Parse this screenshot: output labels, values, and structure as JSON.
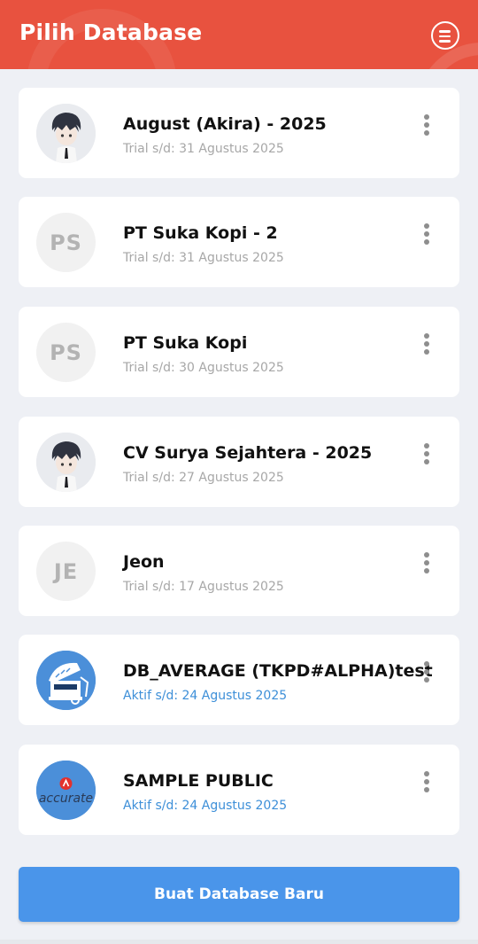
{
  "header": {
    "title": "Pilih Database",
    "menu_icon": "menu-icon"
  },
  "databases": [
    {
      "name": "August (Akira) - 2025",
      "status": "Trial s/d: 31 Agustus 2025",
      "avatar_type": "photo",
      "active": false
    },
    {
      "name": "PT Suka Kopi - 2",
      "status": "Trial s/d: 31 Agustus 2025",
      "avatar_type": "initials",
      "initials": "PS",
      "active": false
    },
    {
      "name": "PT Suka Kopi",
      "status": "Trial s/d: 30 Agustus 2025",
      "avatar_type": "initials",
      "initials": "PS",
      "active": false
    },
    {
      "name": "CV Surya Sejahtera - 2025",
      "status": "Trial s/d: 27 Agustus 2025",
      "avatar_type": "photo",
      "active": false
    },
    {
      "name": "Jeon",
      "status": "Trial s/d: 17 Agustus 2025",
      "avatar_type": "initials",
      "initials": "JE",
      "active": false
    },
    {
      "name": "DB_AVERAGE (TKPD#ALPHA)test",
      "status": "Aktif s/d: 24 Agustus 2025",
      "avatar_type": "cashier-icon",
      "active": true
    },
    {
      "name": "SAMPLE PUBLIC",
      "status": "Aktif s/d: 24 Agustus 2025",
      "avatar_type": "accurate-logo",
      "logo_text": "accurate",
      "active": true
    }
  ],
  "create_button": {
    "label": "Buat Database Baru"
  },
  "colors": {
    "header": "#e8523f",
    "primary_button": "#4a95ea",
    "active_status": "#3d8fd8",
    "trial_status": "#a7a7a7"
  }
}
